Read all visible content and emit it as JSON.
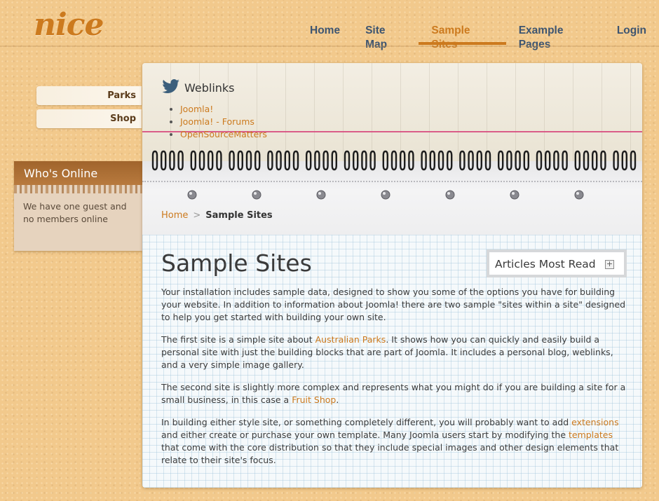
{
  "site": {
    "logo": "nice"
  },
  "topnav": [
    {
      "label": "Home",
      "active": false
    },
    {
      "label": "Site Map",
      "active": false
    },
    {
      "label": "Sample Sites",
      "active": true
    },
    {
      "label": "Example Pages",
      "active": false
    },
    {
      "label": "Login",
      "active": false
    }
  ],
  "sidenav": [
    {
      "label": "Parks"
    },
    {
      "label": "Shop"
    }
  ],
  "whos_online": {
    "title": "Who's Online",
    "text": "We have one guest and no members online"
  },
  "weblinks": {
    "title": "Weblinks",
    "links": [
      "Joomla!",
      "Joomla! - Forums",
      "OpenSourceMatters"
    ]
  },
  "breadcrumb": {
    "home": "Home",
    "separator": ">",
    "current": "Sample Sites"
  },
  "page": {
    "title": "Sample Sites",
    "p1": "Your installation includes sample data, designed to show you some of the options you have for building your website. In addition to information about Joomla! there are two sample \"sites within a site\" designed to help you get started with building your own site.",
    "p2_before": "The first site is a simple site about ",
    "p2_link": "Australian Parks",
    "p2_after": ". It shows how you can quickly and easily build a personal site with just the building blocks that are part of Joomla. It includes a personal blog, weblinks, and a very simple image gallery.",
    "p3_before": "The second site is slightly more complex and represents what you might do if you are building a site for a small business, in this case a ",
    "p3_link": "Fruit Shop",
    "p3_after": ".",
    "p4_a": "In building either style site, or something completely different, you will probably want to add ",
    "p4_link1": "extensions",
    "p4_b": " and either create or purchase your own template. Many Joomla users start by modifying the ",
    "p4_link2": "templates",
    "p4_c": " that come with the core distribution so that they include special images and other design elements that relate to their site's focus."
  },
  "articles_most_read": {
    "title": "Articles Most Read",
    "toggle": "+"
  },
  "colors": {
    "accent": "#cc7a1e",
    "nav": "#3e5570",
    "background": "#f2c98c"
  },
  "icons": {
    "weblinks": "twitter-bird-icon",
    "toggle": "expand-icon"
  }
}
